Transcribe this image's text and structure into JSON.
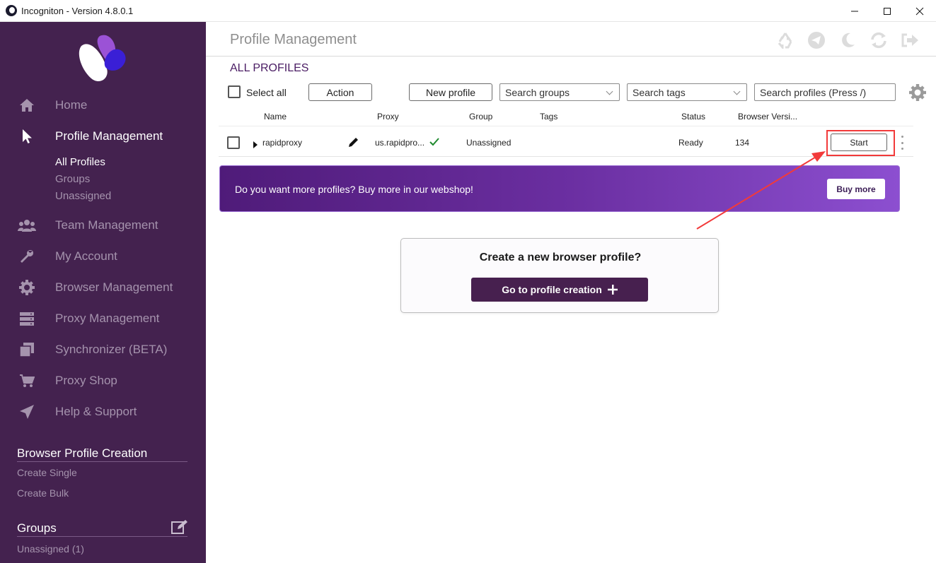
{
  "window": {
    "title": "Incogniton - Version 4.8.0.1",
    "minimize": "—",
    "maximize": "☐",
    "close": "✕"
  },
  "sidebar": {
    "nav": [
      {
        "label": "Home",
        "icon": "home-icon"
      },
      {
        "label": "Profile Management",
        "icon": "cursor-icon",
        "active": true
      },
      {
        "label": "Team Management",
        "icon": "team-icon"
      },
      {
        "label": "My Account",
        "icon": "wrench-icon"
      },
      {
        "label": "Browser Management",
        "icon": "gear-icon"
      },
      {
        "label": "Proxy Management",
        "icon": "server-icon"
      },
      {
        "label": "Synchronizer (BETA)",
        "icon": "stack-icon"
      },
      {
        "label": "Proxy Shop",
        "icon": "cart-icon"
      },
      {
        "label": "Help & Support",
        "icon": "paper-plane-icon"
      }
    ],
    "subnav": [
      "All Profiles",
      "Groups",
      "Unassigned"
    ],
    "creation": {
      "title": "Browser Profile Creation",
      "links": [
        "Create Single",
        "Create Bulk"
      ]
    },
    "groups": {
      "title": "Groups",
      "links": [
        "Unassigned (1)"
      ]
    }
  },
  "main": {
    "page_title": "Profile Management",
    "section_title": "ALL PROFILES",
    "toolbar": {
      "select_all": "Select all",
      "action": "Action",
      "new_profile": "New profile",
      "search_groups": "Search groups",
      "search_tags": "Search tags",
      "search_profiles": "Search profiles (Press /)"
    },
    "columns": [
      "Name",
      "Proxy",
      "Group",
      "Tags",
      "Status",
      "Browser Versi..."
    ],
    "rows": [
      {
        "name": "rapidproxy",
        "proxy": "us.rapidpro...",
        "group": "Unassigned",
        "tags": "",
        "status": "Ready",
        "browser_version": "134",
        "action": "Start"
      }
    ],
    "banner": {
      "text": "Do you want more profiles? Buy more in our webshop!",
      "button": "Buy more"
    },
    "create_card": {
      "title": "Create a new browser profile?",
      "button": "Go to profile creation"
    }
  },
  "colors": {
    "sidebar_bg": "#44224f",
    "accent": "#47204f",
    "highlight": "#f23a3a",
    "ok_green": "#1f8a2e"
  }
}
